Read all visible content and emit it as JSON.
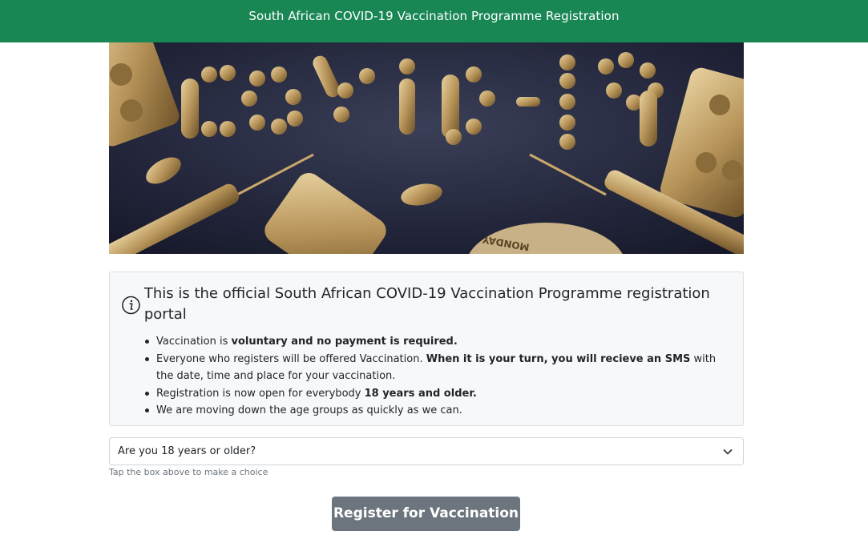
{
  "header": {
    "title": "South African COVID-19 Vaccination Programme Registration"
  },
  "hero": {
    "image_label": "COVID-19",
    "pill_label": "MONDAY"
  },
  "info": {
    "heading": "This is the official South African COVID-19 Vaccination Programme registration portal",
    "bullets": [
      {
        "pre": "Vaccination is ",
        "bold": "voluntary and no payment is required.",
        "post": ""
      },
      {
        "pre": "Everyone who registers will be offered Vaccination. ",
        "bold": "When it is your turn, you will recieve an SMS",
        "post": " with the date, time and place for your vaccination."
      },
      {
        "pre": "Registration is now open for everybody ",
        "bold": "18 years and older.",
        "post": ""
      },
      {
        "pre": "We are moving down the age groups as quickly as we can.",
        "bold": "",
        "post": ""
      }
    ]
  },
  "form": {
    "age_question": "Are you 18 years or older?",
    "help": "Tap the box above to make a choice",
    "submit_label": "Register for Vaccination"
  },
  "colors": {
    "header_bg": "#198754",
    "button_bg": "#6c757d"
  }
}
